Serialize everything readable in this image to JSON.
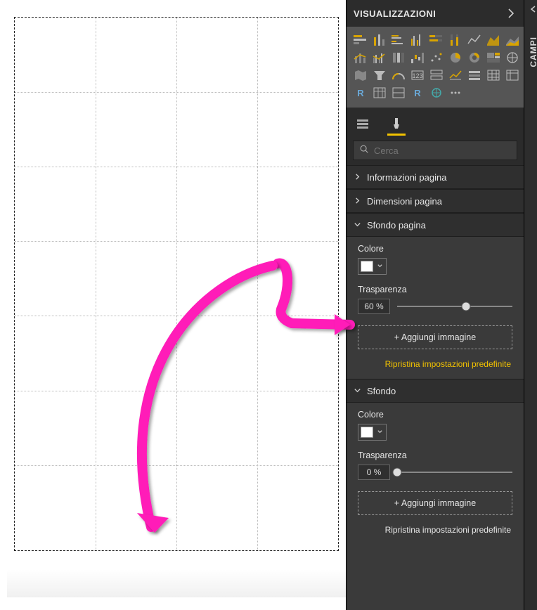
{
  "panels": {
    "viz_title": "VISUALIZZAZIONI",
    "campi_label": "CAMPI"
  },
  "search": {
    "placeholder": "Cerca"
  },
  "sections": {
    "info_pagina": "Informazioni pagina",
    "dimensioni_pagina": "Dimensioni pagina",
    "sfondo_pagina": {
      "title": "Sfondo pagina",
      "colore_label": "Colore",
      "colore_value": "#ffffff",
      "trasparenza_label": "Trasparenza",
      "trasparenza_value": "60  %",
      "trasparenza_percent": 60,
      "add_image": "+ Aggiungi immagine",
      "reset": "Ripristina impostazioni predefinite"
    },
    "sfondo": {
      "title": "Sfondo",
      "colore_label": "Colore",
      "colore_value": "#ffffff",
      "trasparenza_label": "Trasparenza",
      "trasparenza_value": "0 %",
      "trasparenza_percent": 0,
      "add_image": "+ Aggiungi immagine",
      "reset": "Ripristina impostazioni predefinite"
    }
  },
  "annotation": {
    "color": "#ff1bb8"
  }
}
